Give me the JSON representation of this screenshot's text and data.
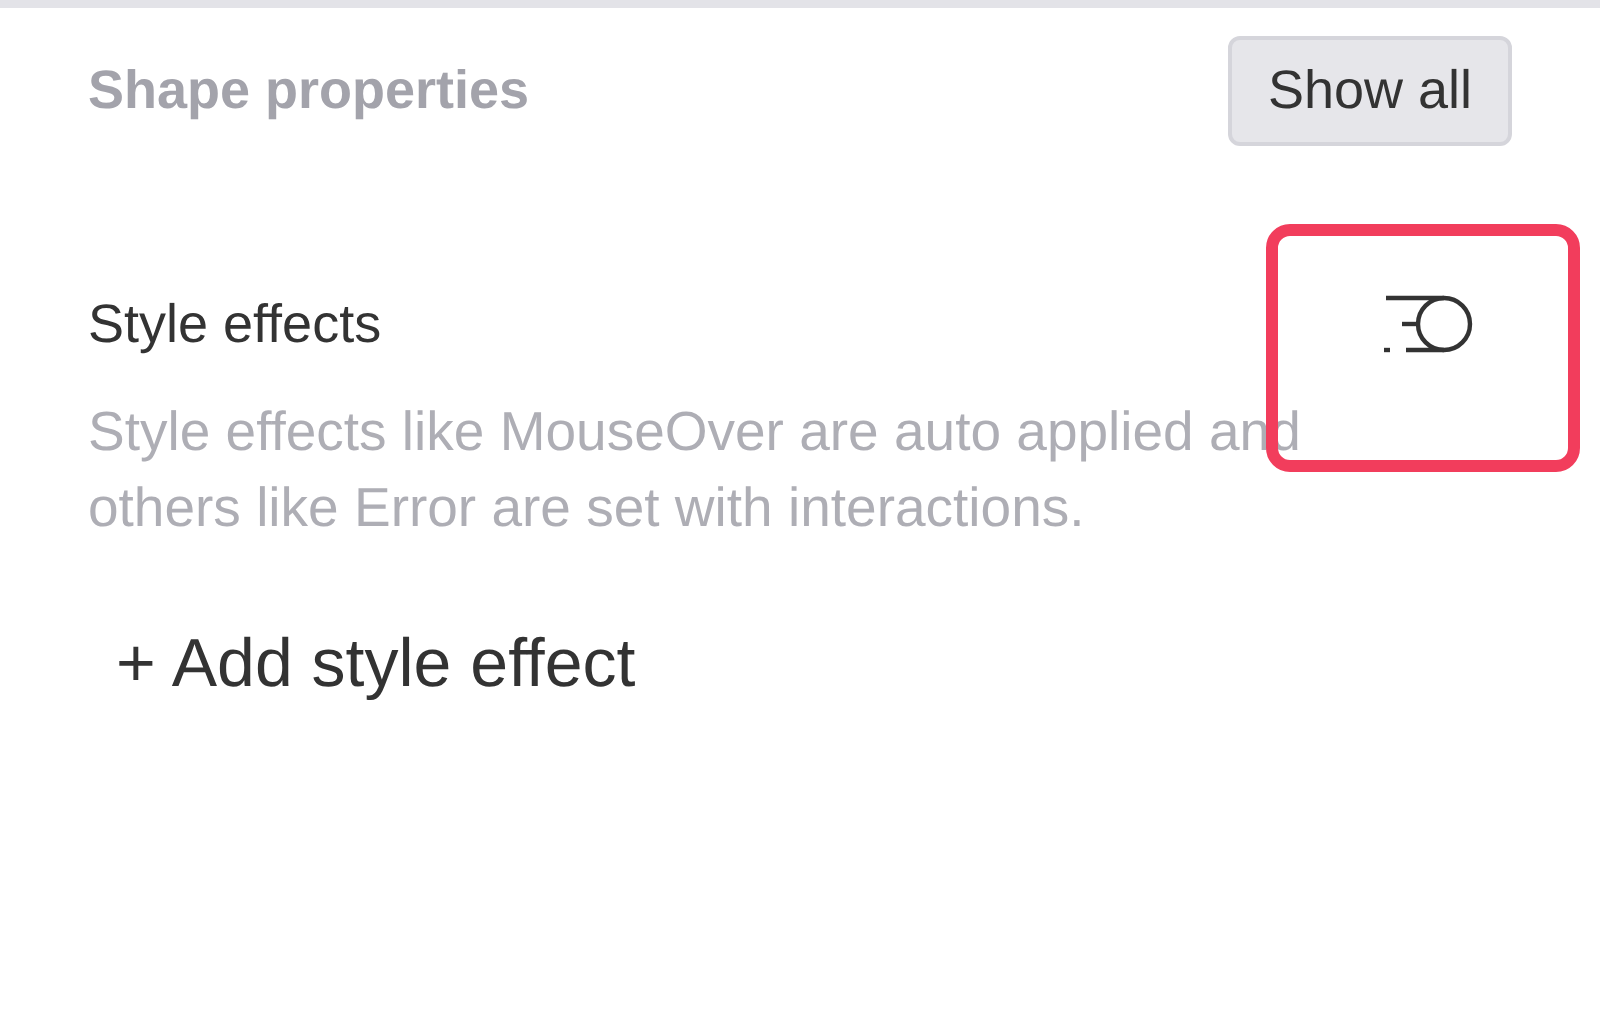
{
  "header": {
    "title": "Shape properties",
    "button": "Show all"
  },
  "section": {
    "title": "Style effects",
    "description": "Style effects like MouseOver are auto applied and others like Error are set with interactions.",
    "highlighted": true
  },
  "add_button": {
    "icon": "+",
    "label": "Add style effect"
  }
}
